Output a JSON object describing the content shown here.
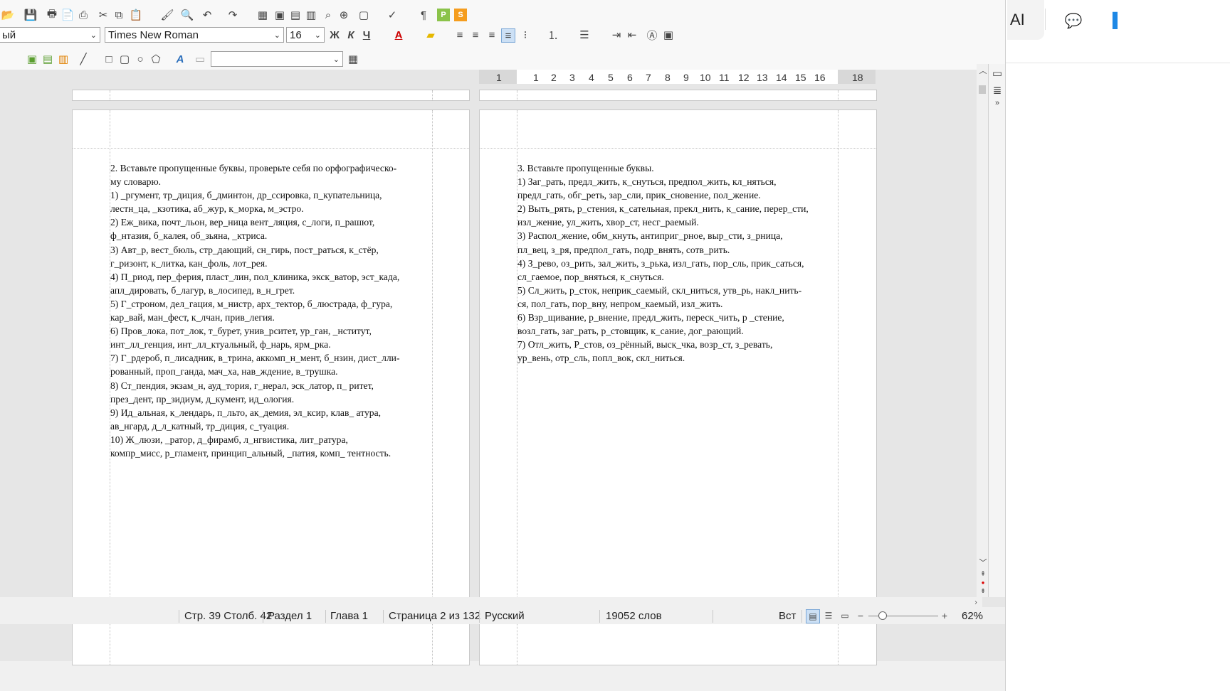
{
  "toolbar": {
    "style_value": "ый",
    "font_name": "Times New Roman",
    "font_size": "16",
    "bold": "Ж",
    "italic": "К",
    "underline": "Ч",
    "font_color": "A",
    "fontwork": "A"
  },
  "ruler": {
    "numbers": [
      "1",
      "1",
      "2",
      "3",
      "4",
      "5",
      "6",
      "7",
      "8",
      "9",
      "10",
      "11",
      "12",
      "13",
      "14",
      "15",
      "16",
      "18"
    ]
  },
  "page_left": {
    "lines": [
      "2. Вставьте пропущенные буквы, проверьте себя по орфографическо-",
      "му словарю.",
      "1) _ргумент, тр_диция, б_дминтон, др_ссировка, п_купательница,",
      "лестн_ца, _кзотика, аб_жур, к_морка, м_эстро.",
      "2) Еж_вика, почт_льон, вер_ница вент_ляция, с_логи, п_рашют,",
      "ф_нтазия, б_калея, об_зьяна, _ктриса.",
      "3) Авт_р, вест_бюль, стр_дающий, сн_гирь, пост_раться, к_стёр,",
      "г_ризонт, к_литка, кан_фоль, лот_рея.",
      "4) П_риод, пер_ферия, пласт_лин, пол_клиника, экск_ватор, эст_када,",
      "апл_дировать, б_лагур, в_лосипед, в_н_грет.",
      "5) Г_строном, дел_гация, м_нистр, арх_тектор, б_люстрада, ф_гура,",
      "кар_вай, ман_фест, к_лчан, прив_легия.",
      "6) Пров_лока, пот_лок, т_бурет, унив_рситет, ур_ган, _нститут,",
      "инт_лл_генция, инт_лл_ктуальный, ф_нарь, ярм_рка.",
      "7) Г_рдероб, п_лисадник, в_трина, аккомп_н_мент, б_нзин, дист_лли-",
      "рованный, проп_ганда, мач_ха, нав_ждение, в_трушка.",
      "8) Ст_пендия, экзам_н, ауд_тория, г_нерал, эск_латор, п_ ритет,",
      "през_дент, пр_зидиум, д_кумент, ид_ология.",
      "9) Ид_альная, к_лендарь, п_льто, ак_демия, эл_ксир, клав_ атура,",
      "ав_нгард, д_л_катный, тр_диция, с_туация.",
      "10) Ж_люзи, _ратор, д_фирамб, л_нгвистика, лит_ратура,",
      "компр_мисс, р_гламент, принцип_альный, _патия, комп_ тентность."
    ]
  },
  "page_right": {
    "lines": [
      "3. Вставьте пропущенные буквы.",
      "1) Заг_рать, предл_жить, к_снуться, предпол_жить, кл_няться,",
      "предл_гать, обг_реть, зар_сли, прик_сновение, пол_жение.",
      "2) Выть_рять, р_стения, к_сательная, прекл_нить, к_сание, перер_сти,",
      "изл_жение, ул_жить, хвор_ст, несг_раемый.",
      "3) Распол_жение, обм_кнуть, антиприг_рное, выр_сти, з_рница,",
      "пл_вец, з_ря, предпол_гать, подр_внять, сотв_рить.",
      "4) З_рево, оз_рить, зал_жить, з_рька, изл_гать, пор_сль, прик_саться,",
      "сл_гаемое, пор_вняться, к_снуться.",
      "5) Сл_жить, р_сток, неприк_саемый, скл_ниться, утв_рь, накл_нить-",
      "ся, пол_гать, пор_вну, непром_каемый, изл_жить.",
      "6) Взр_щивание, р_внение, предл_жить, переск_чить, р _стение,",
      "возл_гать, заг_рать, р_стовщик, к_сание, дог_рающий.",
      "7) Отл_жить, Р_стов, оз_рённый, выск_чка, возр_ст, з_ревать,",
      "ур_вень, отр_сль, попл_вок, скл_ниться."
    ]
  },
  "status": {
    "position": "Стр. 39 Столб. 42",
    "section": "Раздел 1",
    "chapter": "Глава 1",
    "page": "Страница 2 из 132",
    "language": "Русский",
    "words": "19052 слов",
    "insert_mode": "Вст",
    "zoom": "62%"
  },
  "right_panel": {
    "ai_label": "AI"
  }
}
